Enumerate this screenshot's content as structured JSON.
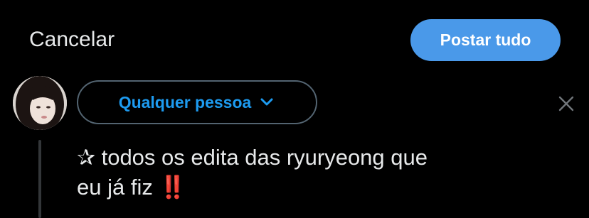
{
  "header": {
    "cancel_label": "Cancelar",
    "post_all_label": "Postar tudo"
  },
  "composer": {
    "audience_label": "Qualquer pessoa",
    "post_text_line1": "✰ todos os edita das ryuryeong que",
    "post_text_line2": "eu já fiz ‼️"
  },
  "colors": {
    "background": "#000000",
    "accent": "#1d9bf0",
    "post_button": "#4a99e9",
    "text": "#e7e9ea",
    "divider": "#333639"
  },
  "icons": {
    "audience_dropdown": "chevron-down-icon",
    "remove": "close-icon"
  }
}
